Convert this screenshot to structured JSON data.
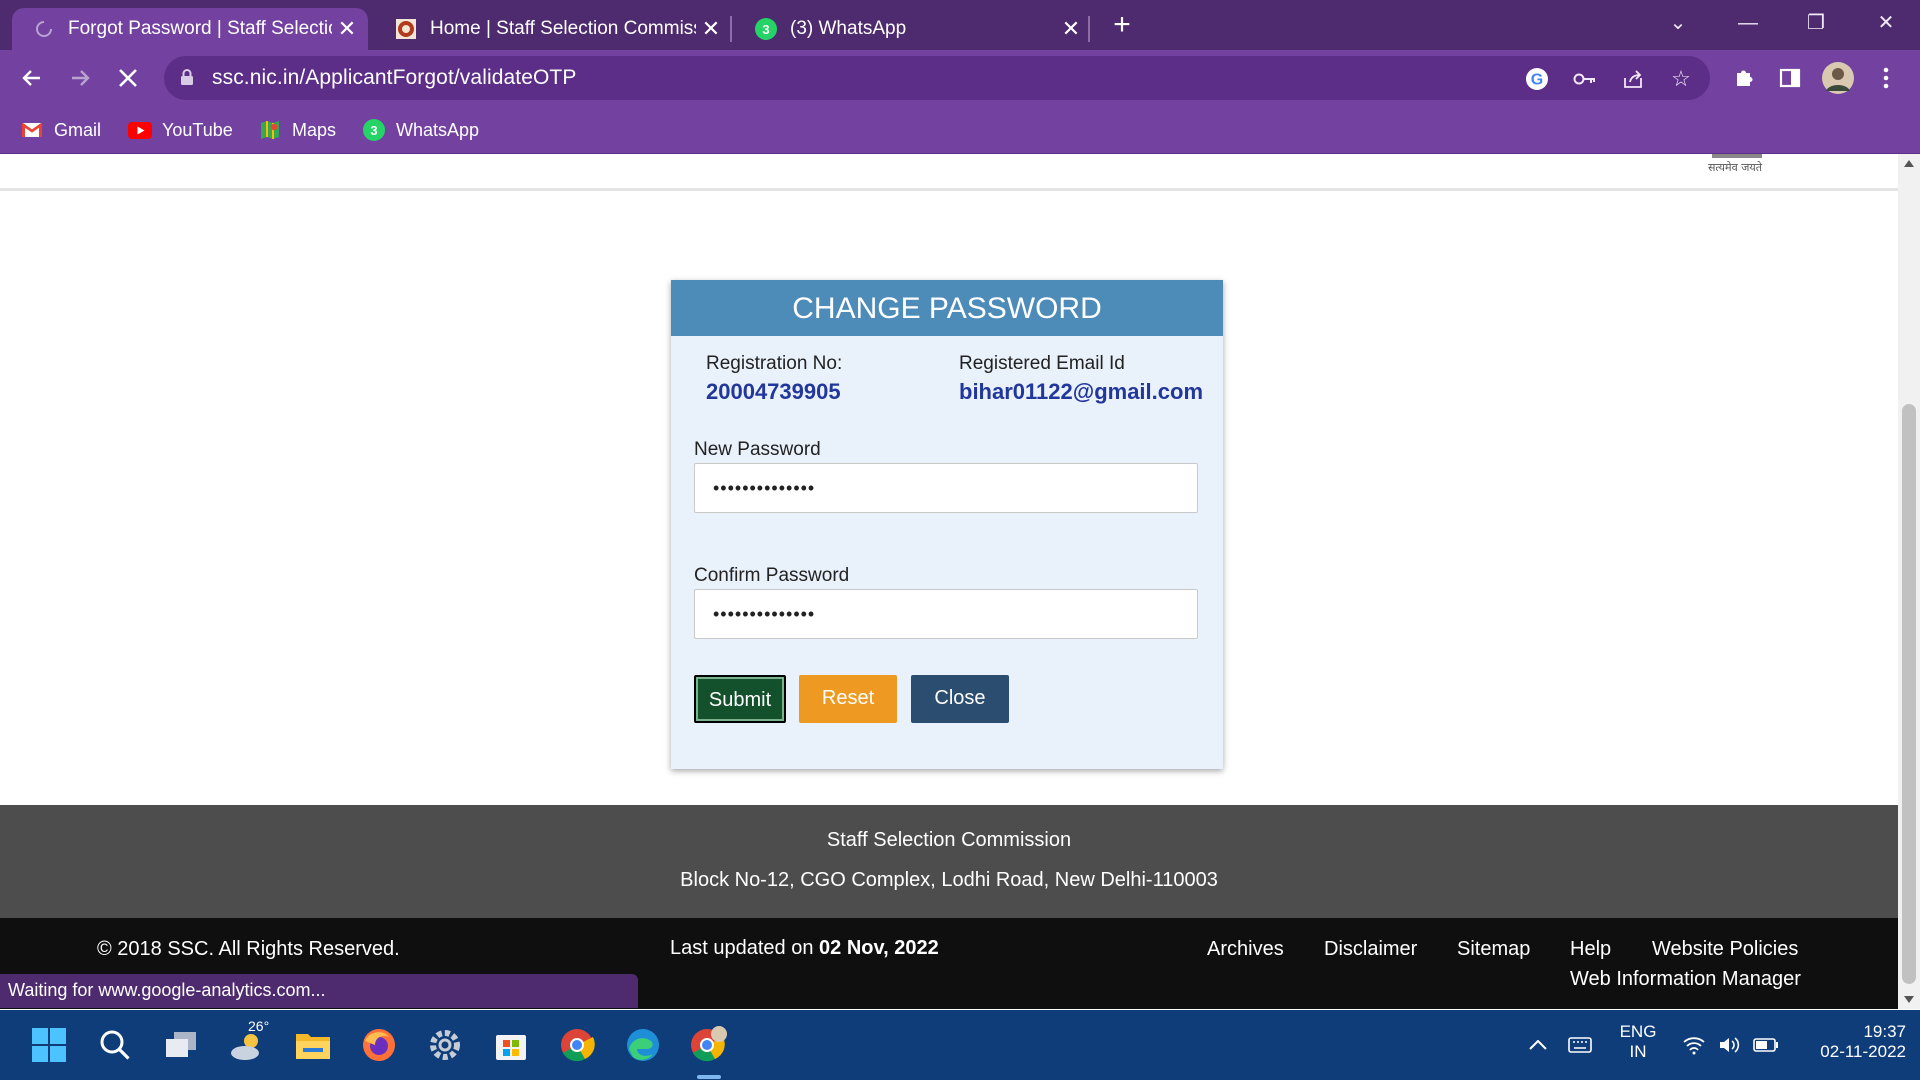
{
  "browser": {
    "tabs": [
      {
        "title": "Forgot Password | Staff Selection",
        "active": true,
        "icon": "loading-spinner-icon"
      },
      {
        "title": "Home | Staff Selection Commissio",
        "active": false,
        "icon": "ssc-favicon-icon"
      },
      {
        "title": "(3) WhatsApp",
        "active": false,
        "icon": "whatsapp-icon"
      }
    ],
    "url": "ssc.nic.in/ApplicantForgot/validateOTP",
    "bookmarks": [
      "Gmail",
      "YouTube",
      "Maps",
      "WhatsApp"
    ],
    "whatsapp_badge": "3",
    "status_text": "Waiting for www.google-analytics.com...",
    "colors": {
      "frame": "#4e2a6e",
      "toolbar": "#7341a0"
    }
  },
  "page": {
    "emblem_caption": "सत्यमेव जयते",
    "form": {
      "title": "CHANGE PASSWORD",
      "registration_label": "Registration No:",
      "registration_value": "20004739905",
      "email_label": "Registered Email Id",
      "email_value": "bihar01122@gmail.com",
      "new_password_label": "New Password",
      "new_password_value": "••••••••••••••",
      "confirm_password_label": "Confirm Password",
      "confirm_password_value": "••••••••••••••",
      "submit_label": "Submit",
      "reset_label": "Reset",
      "close_label": "Close"
    },
    "footer": {
      "org_name": "Staff Selection Commission",
      "address": "Block No-12, CGO Complex, Lodhi Road, New Delhi-110003",
      "copyright": "© 2018 SSC. All Rights Reserved.",
      "last_updated_prefix": "Last updated on",
      "last_updated_date": "02 Nov, 2022",
      "links": [
        "Archives",
        "Disclaimer",
        "Sitemap",
        "Help",
        "Website Policies"
      ],
      "web_info_manager": "Web Information Manager"
    }
  },
  "taskbar": {
    "weather_temp": "26°",
    "lang_top": "ENG",
    "lang_bottom": "IN",
    "time": "19:37",
    "date": "02-11-2022"
  }
}
